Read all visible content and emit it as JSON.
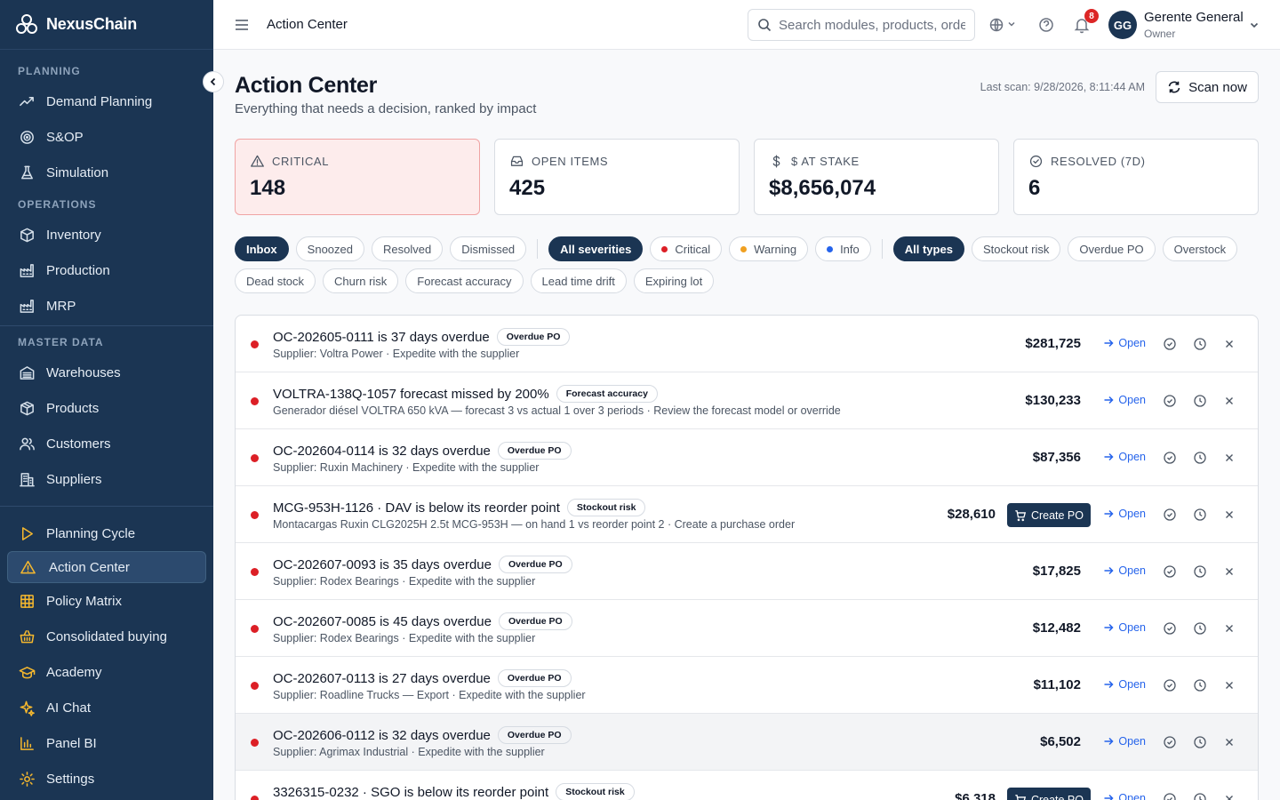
{
  "brand": {
    "name": "NexusChain"
  },
  "sidebar": {
    "planning_label": "PLANNING",
    "planning": [
      {
        "label": "Demand Planning",
        "icon": "trend-icon"
      },
      {
        "label": "S&OP",
        "icon": "target-icon"
      },
      {
        "label": "Simulation",
        "icon": "flask-icon"
      }
    ],
    "operations_label": "OPERATIONS",
    "operations": [
      {
        "label": "Inventory",
        "icon": "box-icon"
      },
      {
        "label": "Production",
        "icon": "factory-icon"
      },
      {
        "label": "MRP",
        "icon": "factory-icon"
      }
    ],
    "master_label": "MASTER DATA",
    "master": [
      {
        "label": "Warehouses",
        "icon": "warehouse-icon"
      },
      {
        "label": "Products",
        "icon": "package-icon"
      },
      {
        "label": "Customers",
        "icon": "users-icon"
      },
      {
        "label": "Suppliers",
        "icon": "building-icon"
      }
    ],
    "tools": [
      {
        "label": "Planning Cycle",
        "icon": "play-icon"
      },
      {
        "label": "Action Center",
        "icon": "alert-triangle-icon",
        "active": true
      },
      {
        "label": "Policy Matrix",
        "icon": "grid-icon"
      },
      {
        "label": "Consolidated buying",
        "icon": "basket-icon"
      },
      {
        "label": "Academy",
        "icon": "graduation-cap-icon"
      },
      {
        "label": "AI Chat",
        "icon": "sparkles-icon"
      },
      {
        "label": "Panel BI",
        "icon": "bar-chart-icon"
      },
      {
        "label": "Settings",
        "icon": "gear-icon"
      }
    ]
  },
  "topbar": {
    "title": "Action Center",
    "search_placeholder": "Search modules, products, orders",
    "notifications": "8",
    "user_initials": "GG",
    "user_name": "Gerente General",
    "user_role": "Owner"
  },
  "page": {
    "title": "Action Center",
    "subtitle": "Everything that needs a decision, ranked by impact",
    "last_scan": "Last scan: 9/28/2026, 8:11:44 AM",
    "scan_button": "Scan now"
  },
  "kpis": [
    {
      "label": "CRITICAL",
      "value": "148",
      "icon": "alert-triangle-icon"
    },
    {
      "label": "OPEN ITEMS",
      "value": "425",
      "icon": "inbox-icon"
    },
    {
      "label": "$ AT STAKE",
      "value": "$8,656,074",
      "icon": "dollar-icon"
    },
    {
      "label": "RESOLVED (7D)",
      "value": "6",
      "icon": "check-circle-icon"
    }
  ],
  "filters": {
    "status": [
      "Inbox",
      "Snoozed",
      "Resolved",
      "Dismissed"
    ],
    "severity": [
      "All severities",
      "Critical",
      "Warning",
      "Info"
    ],
    "types": [
      "All types",
      "Stockout risk",
      "Overdue PO",
      "Overstock",
      "Dead stock",
      "Churn risk",
      "Forecast accuracy",
      "Lead time drift",
      "Expiring lot"
    ]
  },
  "colors": {
    "critical": "#dc1f26",
    "warning": "#f0a020",
    "info": "#2563eb",
    "primary": "#1b3553"
  },
  "actions": {
    "open": "Open",
    "create_po": "Create PO"
  },
  "items": [
    {
      "title": "OC-202605-0111 is 37 days overdue",
      "tag": "Overdue PO",
      "desc": "Supplier: Voltra Power · Expedite with the supplier",
      "amount": "$281,725",
      "create_po": false
    },
    {
      "title": "VOLTRA-138Q-1057 forecast missed by 200%",
      "tag": "Forecast accuracy",
      "desc": "Generador diésel VOLTRA 650 kVA — forecast 3 vs actual 1 over 3 periods · Review the forecast model or override",
      "amount": "$130,233",
      "create_po": false
    },
    {
      "title": "OC-202604-0114 is 32 days overdue",
      "tag": "Overdue PO",
      "desc": "Supplier: Ruxin Machinery · Expedite with the supplier",
      "amount": "$87,356",
      "create_po": false
    },
    {
      "title": "MCG-953H-1126 · DAV is below its reorder point",
      "tag": "Stockout risk",
      "desc": "Montacargas Ruxin CLG2025H 2.5t MCG-953H — on hand 1 vs reorder point 2 · Create a purchase order",
      "amount": "$28,610",
      "create_po": true
    },
    {
      "title": "OC-202607-0093 is 35 days overdue",
      "tag": "Overdue PO",
      "desc": "Supplier: Rodex Bearings · Expedite with the supplier",
      "amount": "$17,825",
      "create_po": false
    },
    {
      "title": "OC-202607-0085 is 45 days overdue",
      "tag": "Overdue PO",
      "desc": "Supplier: Rodex Bearings · Expedite with the supplier",
      "amount": "$12,482",
      "create_po": false
    },
    {
      "title": "OC-202607-0113 is 27 days overdue",
      "tag": "Overdue PO",
      "desc": "Supplier: Roadline Trucks — Export · Expedite with the supplier",
      "amount": "$11,102",
      "create_po": false
    },
    {
      "title": "OC-202606-0112 is 32 days overdue",
      "tag": "Overdue PO",
      "desc": "Supplier: Agrimax Industrial · Expedite with the supplier",
      "amount": "$6,502",
      "create_po": false
    },
    {
      "title": "3326315-0232 · SGO is below its reorder point",
      "tag": "Stockout risk",
      "desc": "",
      "amount": "$6,318",
      "create_po": true
    }
  ]
}
